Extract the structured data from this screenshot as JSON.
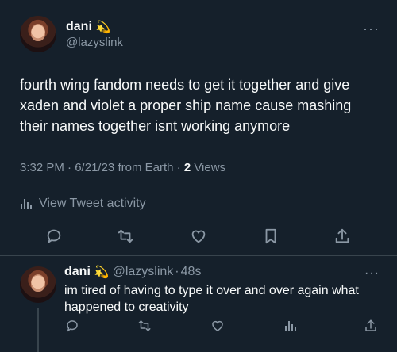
{
  "tweet": {
    "display_name": "dani",
    "emoji": "💫",
    "handle": "@lazyslink",
    "more": "···",
    "text": "fourth wing fandom needs to get it together and give xaden and violet a proper ship name cause mashing their names together isnt working anymore",
    "time": "3:32 PM",
    "date": "6/21/23",
    "source": "from Earth",
    "sep": "·",
    "views_count": "2",
    "views_label": "Views",
    "activity_label": "View Tweet activity"
  },
  "reply": {
    "display_name": "dani",
    "emoji": "💫",
    "handle": "@lazyslink",
    "time": "48s",
    "sep": "·",
    "more": "···",
    "text": "im tired of having to type it over and over again what happened to creativity"
  },
  "icons": {
    "reply": "reply-icon",
    "retweet": "retweet-icon",
    "like": "heart-icon",
    "bookmark": "bookmark-icon",
    "share": "share-icon",
    "analytics": "analytics-icon"
  },
  "colors": {
    "background": "#15202b",
    "text": "#f7f9f9",
    "secondary": "#8b98a5",
    "divider": "#38444d"
  }
}
